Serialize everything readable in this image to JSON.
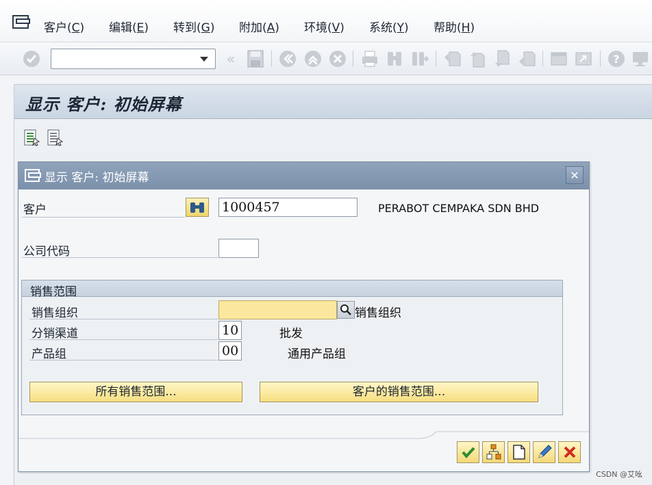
{
  "menu": {
    "items": [
      {
        "label": "客户(",
        "key": "C",
        "close": ")"
      },
      {
        "label": "编辑(",
        "key": "E",
        "close": ")"
      },
      {
        "label": "转到(",
        "key": "G",
        "close": ")"
      },
      {
        "label": "附加(",
        "key": "A",
        "close": ")"
      },
      {
        "label": "环境(",
        "key": "V",
        "close": ")"
      },
      {
        "label": "系统(",
        "key": "Y",
        "close": ")"
      },
      {
        "label": "帮助(",
        "key": "H",
        "close": ")"
      }
    ]
  },
  "toolbar": {
    "command_field_value": "",
    "icons": [
      "enter-icon",
      "back-arrows-icon",
      "save-icon",
      "back-icon",
      "exit-icon",
      "cancel-icon",
      "print-icon",
      "find-icon",
      "find-next-icon",
      "first-page-icon",
      "previous-page-icon",
      "next-page-icon",
      "last-page-icon",
      "new-session-icon",
      "shortcut-icon",
      "help-icon",
      "layout-icon"
    ]
  },
  "screen": {
    "title": "显示 客户: 初始屏幕"
  },
  "dialog": {
    "title": "显示 客户: 初始屏幕",
    "close_label": "✕",
    "customer": {
      "label": "客户",
      "value": "1000457",
      "name": "PERABOT CEMPAKA SDN BHD"
    },
    "company_code": {
      "label": "公司代码",
      "value": ""
    },
    "sales_area": {
      "title": "销售范围",
      "sales_org": {
        "label": "销售组织",
        "value": "",
        "desc": "销售组织"
      },
      "distribution_channel": {
        "label": "分销渠道",
        "value": "10",
        "desc": "批发"
      },
      "division": {
        "label": "产品组",
        "value": "00",
        "desc": "通用产品组"
      },
      "all_areas_button": "所有销售范围...",
      "customer_areas_button": "客户的销售范围..."
    }
  },
  "watermark": "CSDN @艾吆"
}
